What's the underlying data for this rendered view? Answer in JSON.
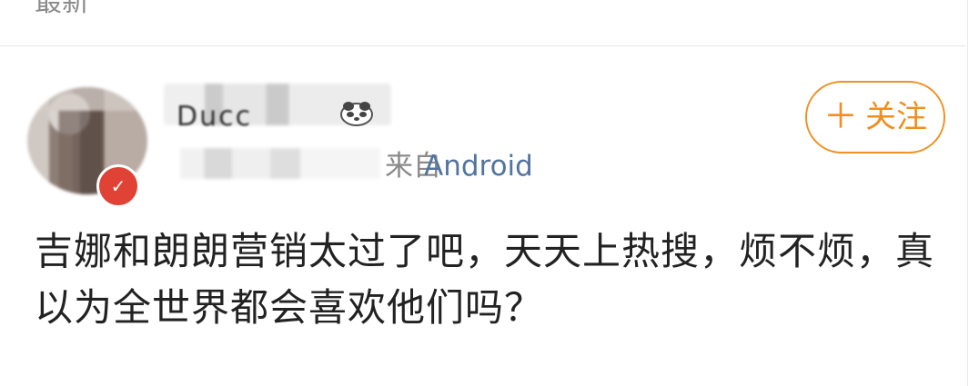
{
  "section": {
    "title": "最新"
  },
  "user": {
    "name_fragment": "Ducc",
    "badge_icon": "verified-v-icon",
    "emoji_icon": "panda-face-icon"
  },
  "post_meta": {
    "source_prefix": "来自",
    "source_app": "Android"
  },
  "follow": {
    "label": "关注",
    "icon": "plus-icon"
  },
  "comment": {
    "text": "吉娜和朗朗营销太过了吧，天天上热搜，烦不烦，真以为全世界都会喜欢他们吗？"
  },
  "colors": {
    "follow_accent": "#f09123",
    "link": "#52749e",
    "text": "#222222",
    "muted": "#8a8a8a",
    "badge": "#e04335"
  }
}
